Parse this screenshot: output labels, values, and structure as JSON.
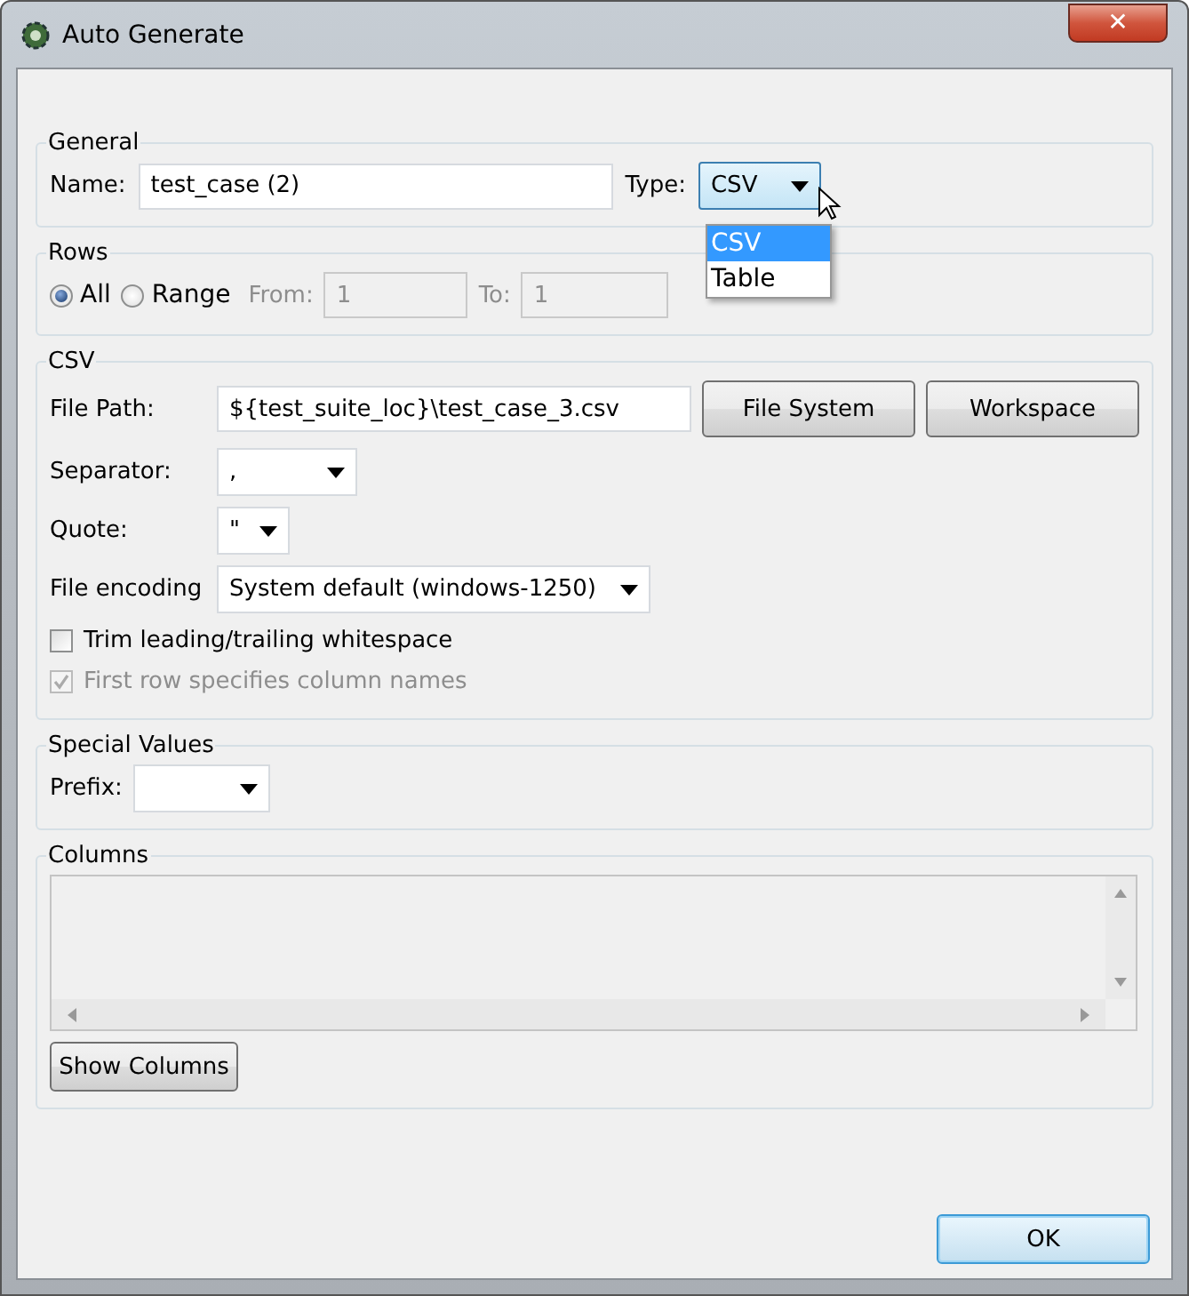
{
  "window": {
    "title": "Auto Generate",
    "close": "✕"
  },
  "general": {
    "legend": "General",
    "name_label": "Name:",
    "name_value": "test_case (2)",
    "type_label": "Type:",
    "type_value": "CSV",
    "type_options": [
      {
        "label": "CSV",
        "selected": true
      },
      {
        "label": "Table",
        "selected": false
      }
    ]
  },
  "rows": {
    "legend": "Rows",
    "options": [
      {
        "label": "All",
        "selected": true
      },
      {
        "label": "Range",
        "selected": false
      }
    ],
    "from_label": "From:",
    "from_value": "1",
    "to_label": "To:",
    "to_value": "1",
    "range_disabled": true
  },
  "csv": {
    "legend": "CSV",
    "file_path_label": "File Path:",
    "file_path_value": "${test_suite_loc}\\test_case_3.csv",
    "buttons": [
      "File System",
      "Workspace"
    ],
    "separator_label": "Separator:",
    "separator_value": ",",
    "quote_label": "Quote:",
    "quote_value": "\"",
    "encoding_label": "File encoding",
    "encoding_value": "System default (windows-1250)",
    "checkboxes": [
      {
        "label": "Trim leading/trailing whitespace",
        "checked": false,
        "disabled": false
      },
      {
        "label": "First row specifies column names",
        "checked": true,
        "disabled": true
      }
    ]
  },
  "special_values": {
    "legend": "Special Values",
    "prefix_label": "Prefix:"
  },
  "columns": {
    "legend": "Columns",
    "button": "Show Columns"
  },
  "ok_button": "OK"
}
